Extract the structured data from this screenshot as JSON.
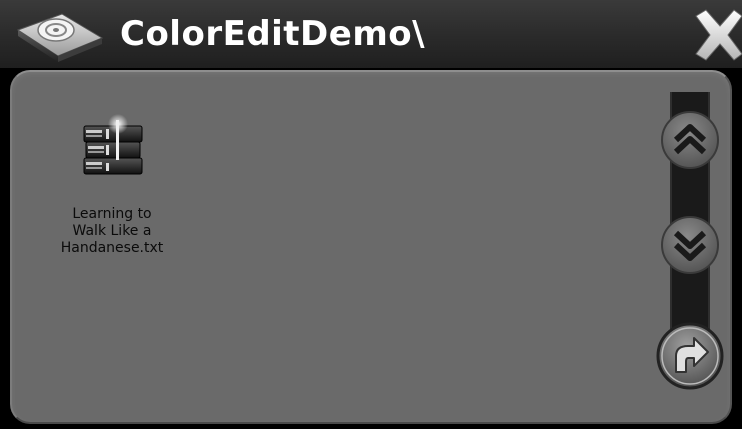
{
  "window": {
    "title": "ColorEditDemo\\",
    "icon": "book-disc-app-icon",
    "close_icon": "close-icon"
  },
  "files": [
    {
      "name": "Learning to\nWalk Like a\nHandanese.txt",
      "icon": "book-stack-icon"
    }
  ],
  "controls": {
    "scroll_up_icon": "double-chevron-up-icon",
    "scroll_down_icon": "double-chevron-down-icon",
    "back_icon": "return-arrow-icon"
  },
  "colors": {
    "header": "#2a2a2a",
    "panel": "#6a6a6a",
    "title_text": "#ffffff",
    "file_text": "#0b0b0b"
  }
}
